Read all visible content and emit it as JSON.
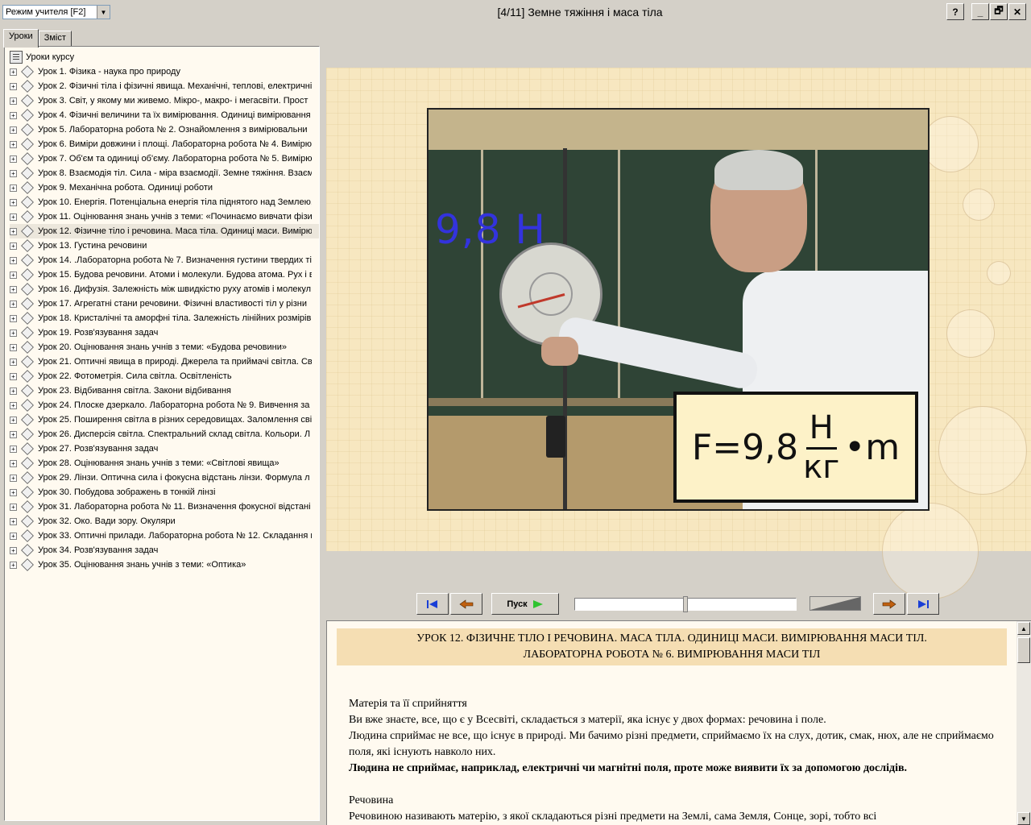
{
  "header": {
    "mode_select_value": "Режим учителя [F2]",
    "window_title": "[4/11] Земне тяжіння і маса тіла",
    "help_label": "?",
    "min_label": "_",
    "restore_label": "🗗",
    "close_label": "✕"
  },
  "left_panel": {
    "tabs": [
      {
        "label": "Уроки",
        "active": true
      },
      {
        "label": "Зміст",
        "active": false
      }
    ],
    "root_label": "Уроки курсу",
    "items": [
      {
        "label": "Урок 1. Фізика - наука про природу"
      },
      {
        "label": "Урок 2. Фізичні тіла і фізичні явища. Механічні, теплові, електричні,"
      },
      {
        "label": "Урок 3. Світ, у якому ми живемо. Мікро-, макро- і мегасвіти. Прост"
      },
      {
        "label": "Урок 4. Фізичні величини та їх вимірювання. Одиниці вимірювання"
      },
      {
        "label": "Урок 5. Лабораторна робота № 2. Ознайомлення з вимірювальни"
      },
      {
        "label": "Урок 6. Виміри довжини і площі. Лабораторна робота № 4. Вимірю"
      },
      {
        "label": "Урок 7. Об'єм та одиниці об'єму. Лабораторна робота № 5. Вимірю"
      },
      {
        "label": "Урок 8. Взаємодія тіл. Сила - міра взаємодії. Земне тяжіння. Взаєм"
      },
      {
        "label": "Урок 9. Механічна робота. Одиниці роботи"
      },
      {
        "label": "Урок 10. Енергія. Потенціальна енергія тіла піднятого над Землею,"
      },
      {
        "label": "Урок 11. Оцінювання знань учнів з теми: «Починаємо вивчати фізи"
      },
      {
        "label": "Урок 12. Фізичне тіло і речовина. Маса тіла. Одиниці маси. Вимірю"
      },
      {
        "label": "Урок 13. Густина речовини"
      },
      {
        "label": "Урок 14. .Лабораторна робота № 7. Визначення густини твердих ті"
      },
      {
        "label": "Урок 15. Будова речовини. Атоми і молекули. Будова атома. Рух і в"
      },
      {
        "label": "Урок 16. Дифузія. Залежність між швидкістю руху атомів і молекул"
      },
      {
        "label": "Урок 17. Агрегатні стани речовини. Фізичні властивості тіл у різни"
      },
      {
        "label": "Урок 18. Кристалічні та аморфні тіла. Залежність лінійних розмірів"
      },
      {
        "label": "Урок 19. Розв'язування задач"
      },
      {
        "label": "Урок 20. Оцінювання знань учнів з теми: «Будова речовини»"
      },
      {
        "label": "Урок 21. Оптичні явища в природі. Джерела та приймачі світла. Св"
      },
      {
        "label": "Урок 22. Фотометрія. Сила світла. Освітленість"
      },
      {
        "label": "Урок 23. Відбивання світла. Закони відбивання"
      },
      {
        "label": "Урок 24. Плоске дзеркало. Лабораторна робота № 9. Вивчення за"
      },
      {
        "label": "Урок 25. Поширення світла в різних середовищах. Заломлення світ"
      },
      {
        "label": "Урок 26. Дисперсія світла. Спектральний склад світла. Кольори. Л"
      },
      {
        "label": "Урок 27. Розв'язування задач"
      },
      {
        "label": "Урок 28. Оцінювання знань учнів з теми: «Світлові явища»"
      },
      {
        "label": "Урок 29. Лінзи. Оптична сила і фокусна відстань лінзи. Формула л"
      },
      {
        "label": "Урок 30. Побудова зображень в тонкій лінзі"
      },
      {
        "label": "Урок 31. Лабораторна робота № 11. Визначення фокусної відстані"
      },
      {
        "label": "Урок 32. Око. Вади зору. Окуляри"
      },
      {
        "label": "Урок 33. Оптичні прилади. Лабораторна робота № 12. Складання н"
      },
      {
        "label": "Урок 34. Розв'язування задач"
      },
      {
        "label": "Урок 35. Оцінювання знань учнів з теми: «Оптика»"
      }
    ]
  },
  "video": {
    "overlay_value": "9,8 Н",
    "formula_lhs": "F=9,8",
    "formula_num": "Н",
    "formula_den": "кг",
    "formula_rhs": "•m"
  },
  "controls": {
    "play_label": "Пуск"
  },
  "text": {
    "title_line1": "УРОК 12. ФІЗИЧНЕ ТІЛО І РЕЧОВИНА. МАСА ТІЛА. ОДИНИЦІ МАСИ. ВИМІРЮВАННЯ МАСИ ТІЛ.",
    "title_line2": "ЛАБОРАТОРНА РОБОТА № 6. ВИМІРЮВАННЯ МАСИ ТІЛ",
    "heading1": "Матерія та її сприйняття",
    "p1": "Ви вже знаєте, все, що є у Всесвіті, складається з матерії, яка існує у двох формах: речовина і поле.",
    "p2": "Людина сприймає не все, що існує в природі. Ми бачимо різні предмети, сприймаємо їх на слух, дотик, смак, нюх, але не сприймаємо поля, які існують навколо них.",
    "p3": "Людина не сприймає, наприклад, електричні чи магнітні поля, проте може виявити їх за допомогою дослідів.",
    "heading2": "Речовина",
    "p4": "Речовиною називають матерію, з якої складаються різні предмети на Землі, сама Земля, Сонце, зорі, тобто всі"
  }
}
